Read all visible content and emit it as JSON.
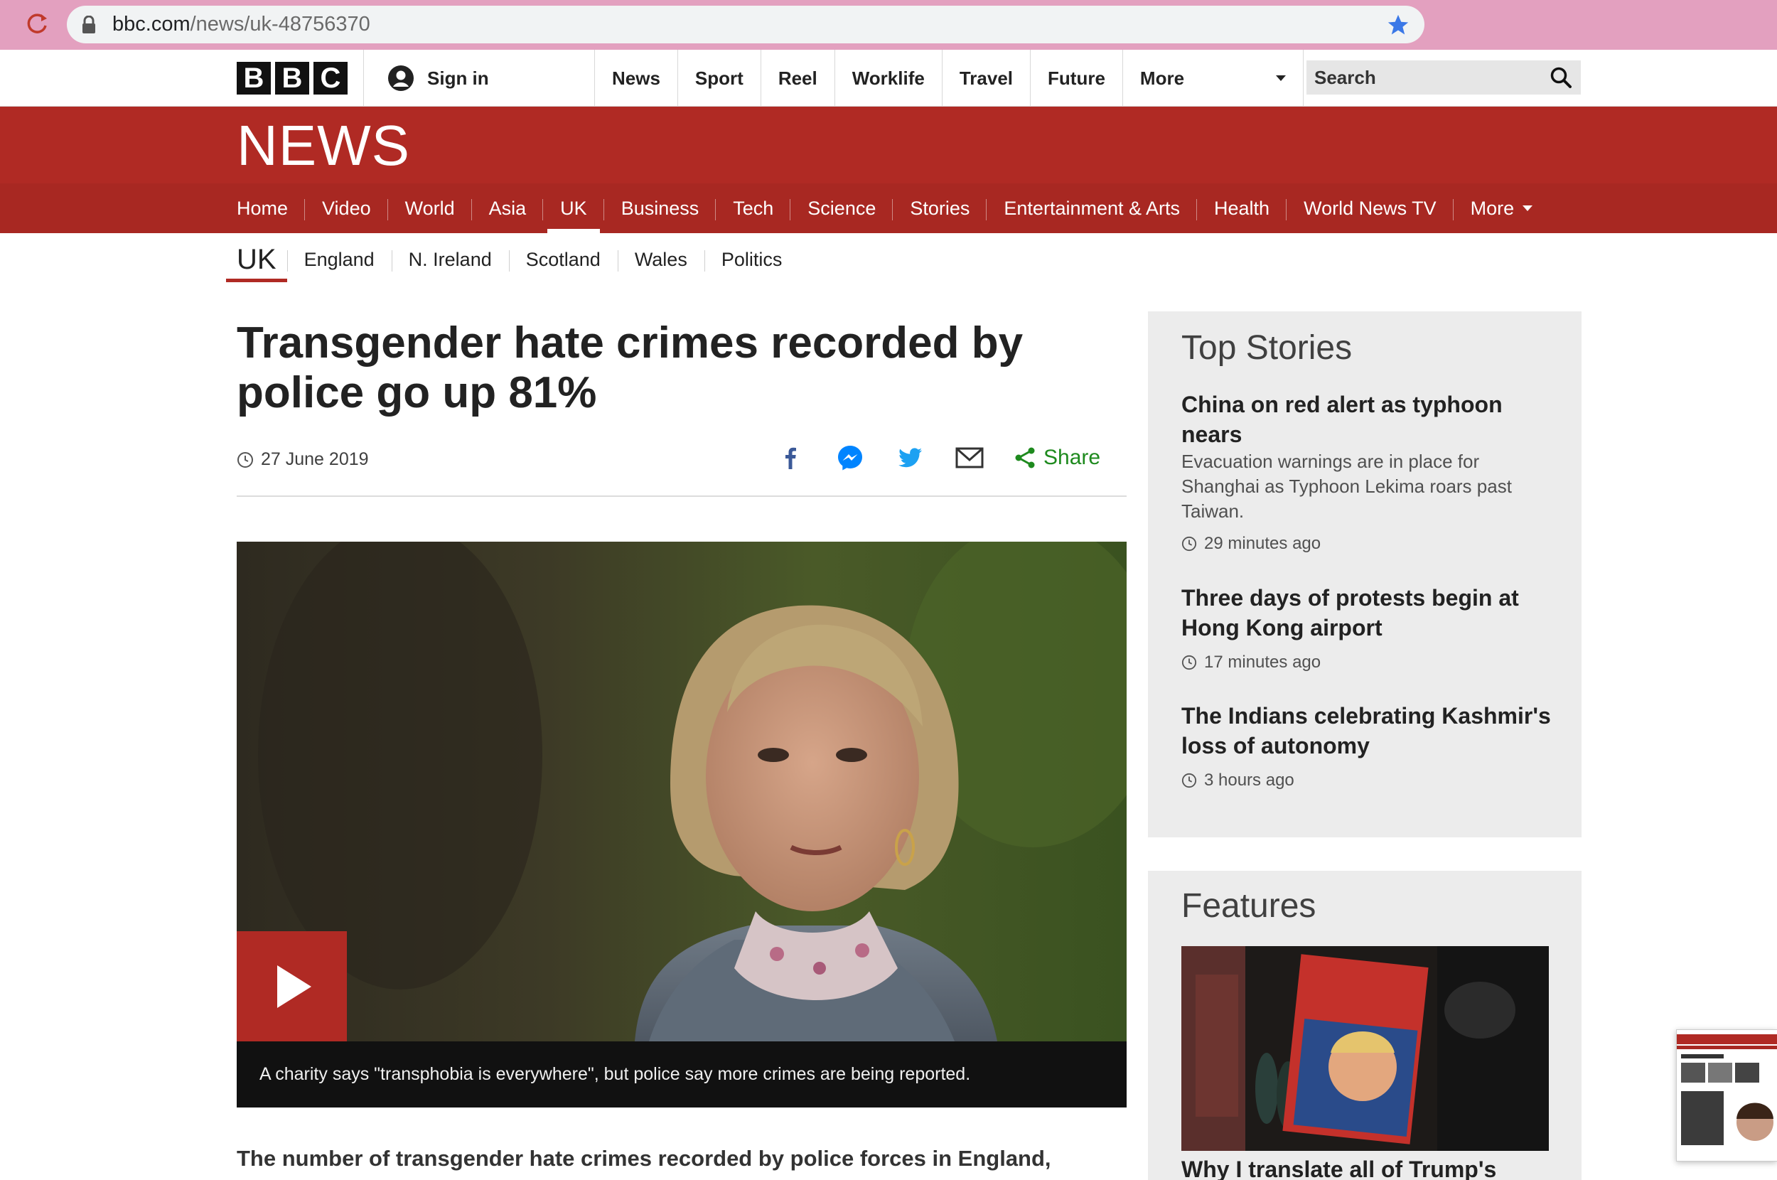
{
  "browser": {
    "url_host": "bbc.com",
    "url_path": "/news/uk-48756370"
  },
  "masthead": {
    "logo_letters": [
      "B",
      "B",
      "C"
    ],
    "sign_in": "Sign in",
    "nav": [
      "News",
      "Sport",
      "Reel",
      "Worklife",
      "Travel",
      "Future"
    ],
    "more": "More",
    "search_placeholder": "Search"
  },
  "news_brand": "NEWS",
  "section_nav": [
    "Home",
    "Video",
    "World",
    "Asia",
    "UK",
    "Business",
    "Tech",
    "Science",
    "Stories",
    "Entertainment & Arts",
    "Health",
    "World News TV",
    "More"
  ],
  "section_nav_active": "UK",
  "subnav": {
    "current": "UK",
    "items": [
      "England",
      "N. Ireland",
      "Scotland",
      "Wales",
      "Politics"
    ]
  },
  "article": {
    "headline": "Transgender hate crimes recorded by police go up 81%",
    "date": "27 June 2019",
    "share": "Share",
    "video_caption": "A charity says \"transphobia is everywhere\", but police say more crimes are being reported.",
    "lede": "The number of transgender hate crimes recorded by police forces in England,"
  },
  "top_stories": {
    "title": "Top Stories",
    "items": [
      {
        "title": "China on red alert as typhoon nears",
        "summary": "Evacuation warnings are in place for Shanghai as Typhoon Lekima roars past Taiwan.",
        "time": "29 minutes ago"
      },
      {
        "title": "Three days of protests begin at Hong Kong airport",
        "summary": "",
        "time": "17 minutes ago"
      },
      {
        "title": "The Indians celebrating Kashmir's loss of autonomy",
        "summary": "",
        "time": "3 hours ago"
      }
    ]
  },
  "features": {
    "title": "Features",
    "first_title": "Why I translate all of Trump's"
  },
  "colors": {
    "bbc_red": "#b02a24",
    "share_green": "#1e8a1e",
    "facebook": "#3b5998",
    "messenger": "#0084ff",
    "twitter": "#1da1f2",
    "chrome_pink": "#e3a0bf"
  }
}
